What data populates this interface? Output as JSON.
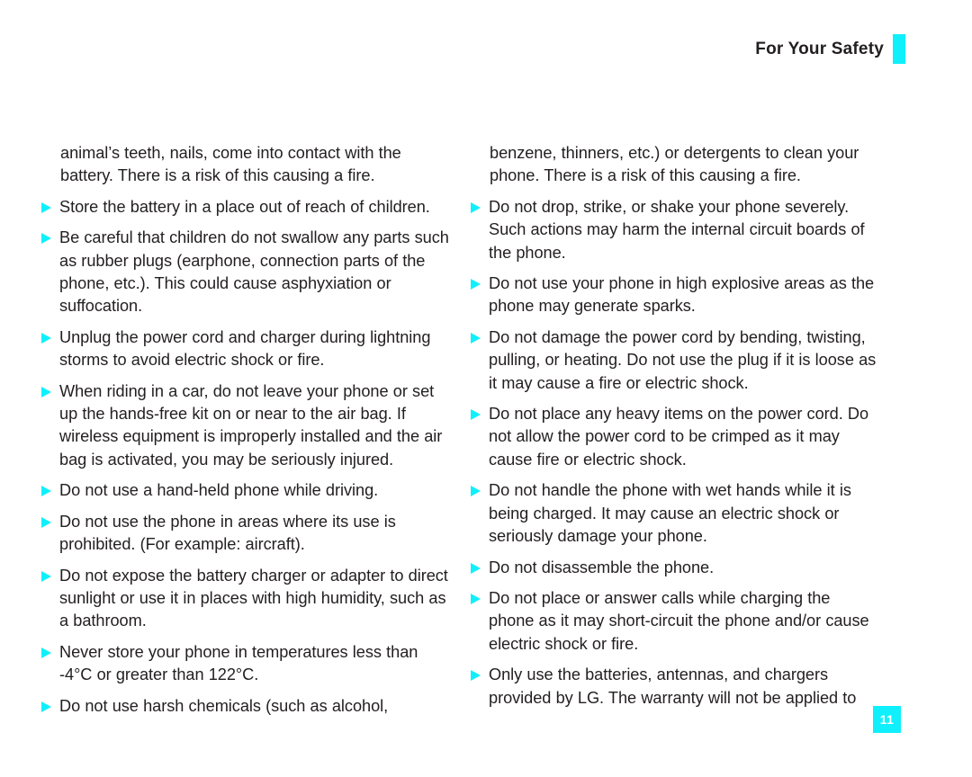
{
  "header": {
    "title": "For Your Safety",
    "marker_color": "#0ff0fc"
  },
  "page": {
    "number": "11",
    "badge_color": "#0ff0fc",
    "text_color": "#231f20"
  },
  "columns": [
    {
      "name": "left-column",
      "blocks": [
        {
          "bulleted": false,
          "text": "animal’s teeth, nails, come into contact with the battery. There is a risk of this causing a fire."
        },
        {
          "bulleted": true,
          "text": "Store the battery in a place out of reach of children."
        },
        {
          "bulleted": true,
          "text": "Be careful that children do not swallow any parts such as rubber plugs (earphone, connection parts of the phone, etc.). This could cause asphyxiation or suffocation."
        },
        {
          "bulleted": true,
          "text": "Unplug the power cord and charger during lightning storms to avoid electric shock or fire."
        },
        {
          "bulleted": true,
          "text": "When riding in a car, do not leave your phone or set up the hands-free kit on or near to the air bag. If wireless equipment is improperly installed and the air bag is activated, you may be seriously injured."
        },
        {
          "bulleted": true,
          "text": "Do not use a hand-held phone while driving."
        },
        {
          "bulleted": true,
          "text": "Do not use the phone in areas where its use is prohibited. (For example: aircraft)."
        },
        {
          "bulleted": true,
          "text": "Do not expose the battery charger or adapter to direct sunlight or use it in places with high humidity, such as a bathroom."
        },
        {
          "bulleted": true,
          "text": "Never store your phone in temperatures less than -4°C or greater than 122°C."
        },
        {
          "bulleted": true,
          "text": "Do not use harsh chemicals (such as alcohol,"
        }
      ]
    },
    {
      "name": "right-column",
      "blocks": [
        {
          "bulleted": false,
          "text": "benzene, thinners, etc.) or detergents to clean your phone. There is a risk of this causing a fire."
        },
        {
          "bulleted": true,
          "text": "Do not drop, strike, or shake your phone severely. Such actions may harm the internal circuit boards of the phone."
        },
        {
          "bulleted": true,
          "text": "Do not use your phone in high explosive areas as the phone may generate sparks."
        },
        {
          "bulleted": true,
          "text": "Do not damage the power cord by bending, twisting, pulling, or heating. Do not use the plug if it is loose as it may cause a fire or electric shock."
        },
        {
          "bulleted": true,
          "text": "Do not place any heavy items on the power cord. Do not allow the power cord to be crimped as it may cause fire or electric shock."
        },
        {
          "bulleted": true,
          "text": "Do not handle the phone with wet hands while it is being charged. It may cause an electric shock or seriously damage your phone."
        },
        {
          "bulleted": true,
          "text": "Do not disassemble the phone."
        },
        {
          "bulleted": true,
          "text": "Do not place or answer calls while charging the phone as it may short-circuit the phone and/or cause electric shock or fire."
        },
        {
          "bulleted": true,
          "text": "Only use the batteries, antennas, and chargers provided by LG. The warranty will not be applied to"
        }
      ]
    }
  ]
}
